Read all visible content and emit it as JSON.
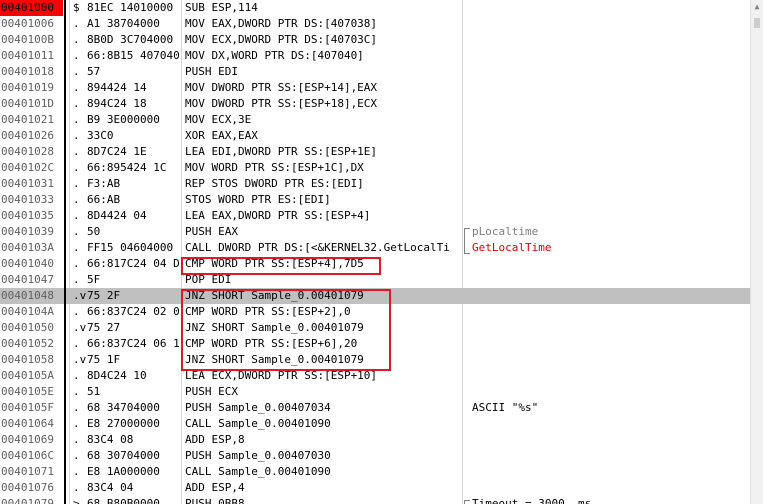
{
  "rows": [
    {
      "addr": "00401000",
      "mark": "$",
      "hex": "81EC 14010000",
      "asm": "SUB ESP,114",
      "cmt": ""
    },
    {
      "addr": "00401006",
      "mark": ".",
      "hex": "A1 38704000",
      "asm": "MOV EAX,DWORD PTR DS:[407038]",
      "cmt": ""
    },
    {
      "addr": "0040100B",
      "mark": ".",
      "hex": "8B0D 3C704000",
      "asm": "MOV ECX,DWORD PTR DS:[40703C]",
      "cmt": ""
    },
    {
      "addr": "00401011",
      "mark": ".",
      "hex": "66:8B15 407040",
      "asm": "MOV DX,WORD PTR DS:[407040]",
      "cmt": ""
    },
    {
      "addr": "00401018",
      "mark": ".",
      "hex": "57",
      "asm": "PUSH EDI",
      "cmt": ""
    },
    {
      "addr": "00401019",
      "mark": ".",
      "hex": "894424 14",
      "asm": "MOV DWORD PTR SS:[ESP+14],EAX",
      "cmt": ""
    },
    {
      "addr": "0040101D",
      "mark": ".",
      "hex": "894C24 18",
      "asm": "MOV DWORD PTR SS:[ESP+18],ECX",
      "cmt": ""
    },
    {
      "addr": "00401021",
      "mark": ".",
      "hex": "B9 3E000000",
      "asm": "MOV ECX,3E",
      "cmt": ""
    },
    {
      "addr": "00401026",
      "mark": ".",
      "hex": "33C0",
      "asm": "XOR EAX,EAX",
      "cmt": ""
    },
    {
      "addr": "00401028",
      "mark": ".",
      "hex": "8D7C24 1E",
      "asm": "LEA EDI,DWORD PTR SS:[ESP+1E]",
      "cmt": ""
    },
    {
      "addr": "0040102C",
      "mark": ".",
      "hex": "66:895424 1C",
      "asm": "MOV WORD PTR SS:[ESP+1C],DX",
      "cmt": ""
    },
    {
      "addr": "00401031",
      "mark": ".",
      "hex": "F3:AB",
      "asm": "REP STOS DWORD PTR ES:[EDI]",
      "cmt": ""
    },
    {
      "addr": "00401033",
      "mark": ".",
      "hex": "66:AB",
      "asm": "STOS WORD PTR ES:[EDI]",
      "cmt": ""
    },
    {
      "addr": "00401035",
      "mark": ".",
      "hex": "8D4424 04",
      "asm": "LEA EAX,DWORD PTR SS:[ESP+4]",
      "cmt": ""
    },
    {
      "addr": "00401039",
      "mark": ".",
      "hex": "50",
      "asm": "PUSH EAX",
      "cmt": "pLocaltime"
    },
    {
      "addr": "0040103A",
      "mark": ".",
      "hex": "FF15 04604000",
      "asm": "CALL DWORD PTR DS:[<&KERNEL32.GetLocalTi",
      "cmt": "GetLocalTime"
    },
    {
      "addr": "00401040",
      "mark": ".",
      "hex": "66:817C24 04 D",
      "asm": "CMP WORD PTR SS:[ESP+4],7D5",
      "cmt": ""
    },
    {
      "addr": "00401047",
      "mark": ".",
      "hex": "5F",
      "asm": "POP EDI",
      "cmt": ""
    },
    {
      "addr": "00401048",
      "mark": ".v",
      "hex": "75 2F",
      "asm": "JNZ SHORT Sample_0.00401079",
      "cmt": ""
    },
    {
      "addr": "0040104A",
      "mark": ".",
      "hex": "66:837C24 02 0",
      "asm": "CMP WORD PTR SS:[ESP+2],0",
      "cmt": ""
    },
    {
      "addr": "00401050",
      "mark": ".v",
      "hex": "75 27",
      "asm": "JNZ SHORT Sample_0.00401079",
      "cmt": ""
    },
    {
      "addr": "00401052",
      "mark": ".",
      "hex": "66:837C24 06 1",
      "asm": "CMP WORD PTR SS:[ESP+6],20",
      "cmt": ""
    },
    {
      "addr": "00401058",
      "mark": ".v",
      "hex": "75 1F",
      "asm": "JNZ SHORT Sample_0.00401079",
      "cmt": ""
    },
    {
      "addr": "0040105A",
      "mark": ".",
      "hex": "8D4C24 10",
      "asm": "LEA ECX,DWORD PTR SS:[ESP+10]",
      "cmt": ""
    },
    {
      "addr": "0040105E",
      "mark": ".",
      "hex": "51",
      "asm": "PUSH ECX",
      "cmt": ""
    },
    {
      "addr": "0040105F",
      "mark": ".",
      "hex": "68 34704000",
      "asm": "PUSH Sample_0.00407034",
      "cmt": "ASCII \"%s\""
    },
    {
      "addr": "00401064",
      "mark": ".",
      "hex": "E8 27000000",
      "asm": "CALL Sample_0.00401090",
      "cmt": ""
    },
    {
      "addr": "00401069",
      "mark": ".",
      "hex": "83C4 08",
      "asm": "ADD ESP,8",
      "cmt": ""
    },
    {
      "addr": "0040106C",
      "mark": ".",
      "hex": "68 30704000",
      "asm": "PUSH Sample_0.00407030",
      "cmt": ""
    },
    {
      "addr": "00401071",
      "mark": ".",
      "hex": "E8 1A000000",
      "asm": "CALL Sample_0.00401090",
      "cmt": ""
    },
    {
      "addr": "00401076",
      "mark": ".",
      "hex": "83C4 04",
      "asm": "ADD ESP,4",
      "cmt": ""
    },
    {
      "addr": "00401079",
      "mark": "> ",
      "hex": "68 B80B0000",
      "asm": "PUSH 0BB8",
      "cmt": "Timeout = 3000. ms"
    }
  ],
  "eip_row_index": 0,
  "selected_row_index": 18,
  "grey_comment_row_indices": [
    14
  ],
  "red_comment_row_indices": [
    15
  ],
  "colors": {
    "eip_background": "#ff0000",
    "selection": "#c0c0c0",
    "highlight_box": "#e01a22",
    "comment_red": "#e00000",
    "comment_grey": "#808080"
  },
  "icons": {
    "scroll_up": "triangle-up-icon"
  }
}
